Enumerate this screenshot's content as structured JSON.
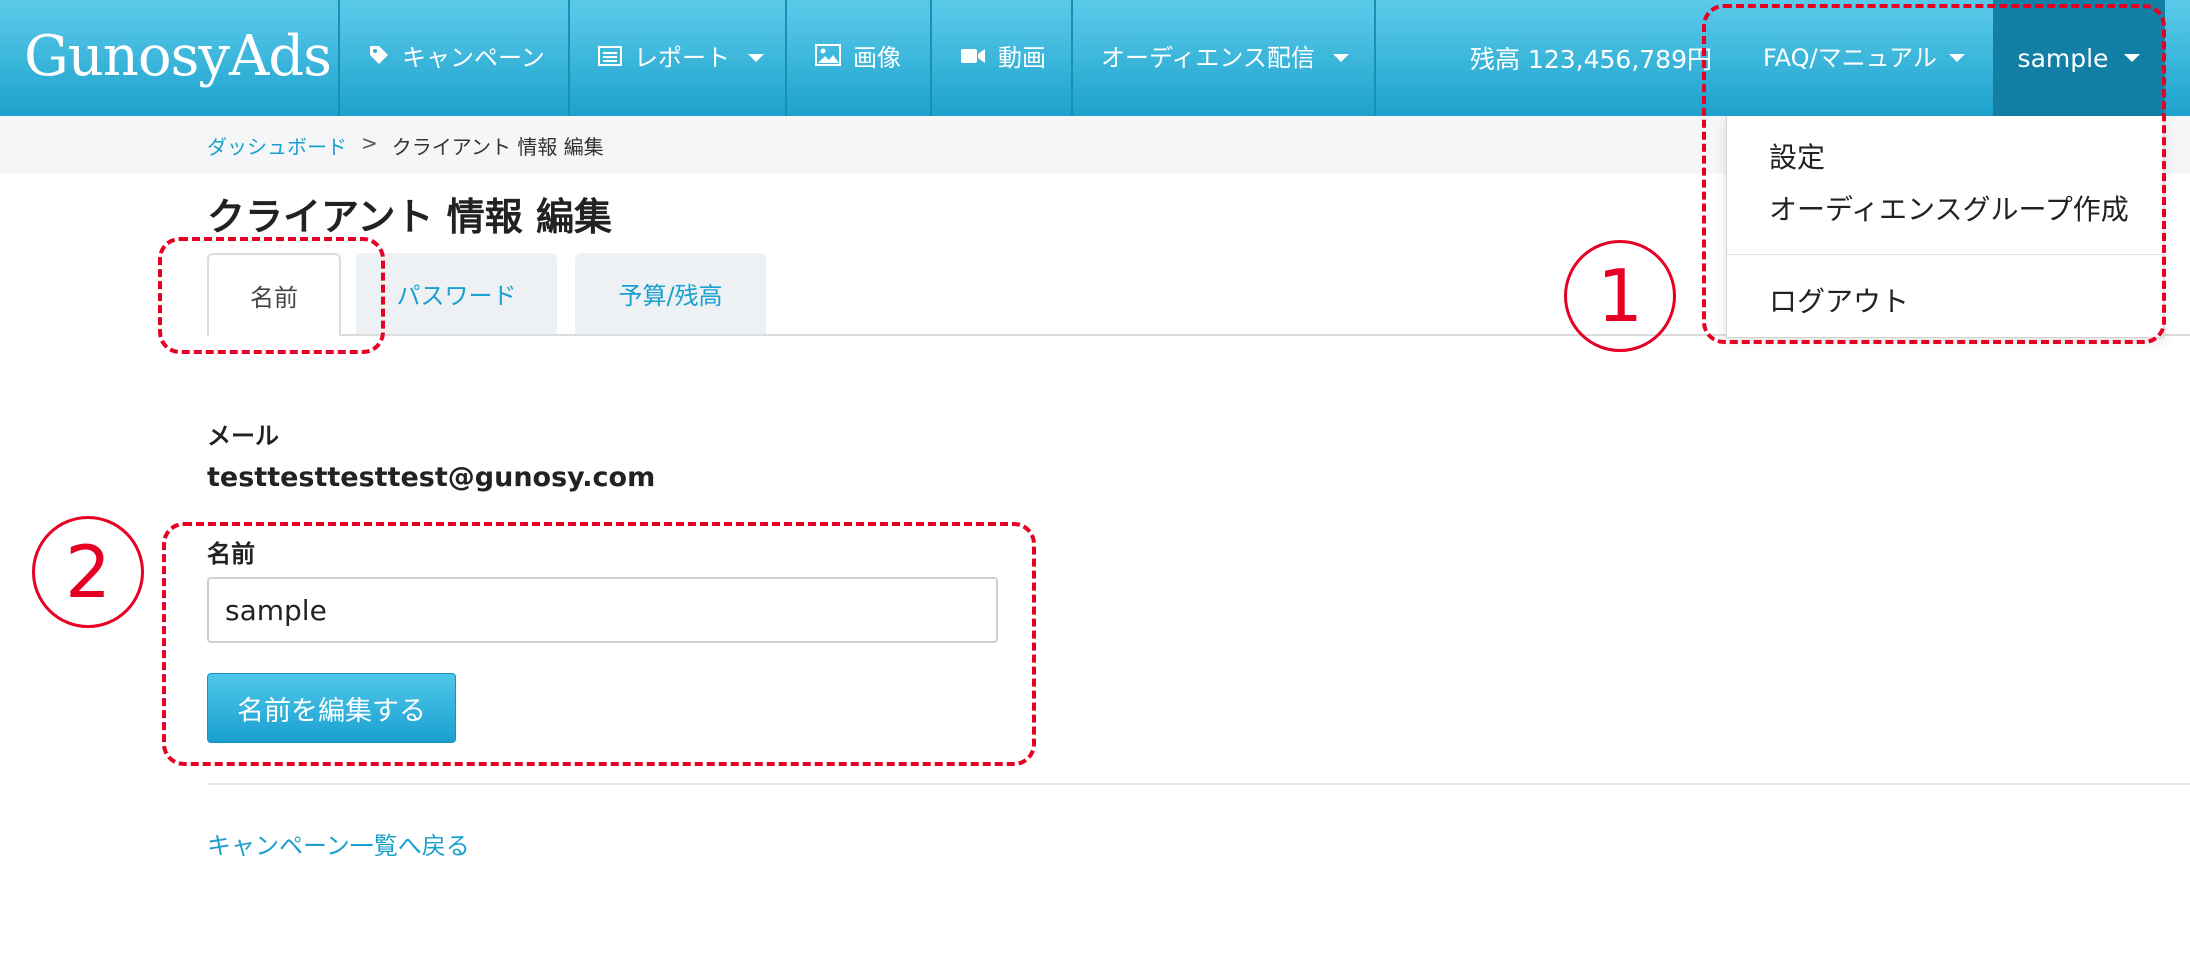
{
  "header": {
    "brand": "GunosyAds",
    "nav": {
      "campaign": "キャンペーン",
      "report": "レポート",
      "image": "画像",
      "video": "動画",
      "audience": "オーディエンス配信"
    },
    "balance": "残高 123,456,789円",
    "faq": "FAQ/マニュアル",
    "user": "sample"
  },
  "user_menu": {
    "items": [
      "設定",
      "オーディエンスグループ作成",
      "ログアウト"
    ]
  },
  "breadcrumb": {
    "home": "ダッシュボード",
    "separator": ">",
    "current": "クライアント 情報 編集"
  },
  "page": {
    "title": "クライアント 情報 編集",
    "tabs": [
      "名前",
      "パスワード",
      "予算/残高"
    ],
    "email_label": "メール",
    "email_value": "testtesttesttest@gunosy.com",
    "name_label": "名前",
    "name_value": "sample",
    "submit_label": "名前を編集する",
    "back_link": "キャンペーン一覧へ戻る"
  },
  "annotations": {
    "marker1": "1",
    "marker2": "2",
    "color": "#e60023"
  },
  "colors": {
    "nav_top": "#5ccbea",
    "nav_bottom": "#1da2cd",
    "link": "#1aa0cf"
  }
}
